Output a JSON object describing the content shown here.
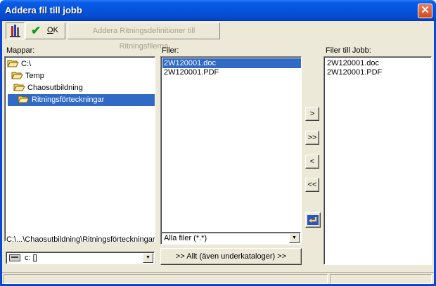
{
  "window": {
    "title": "Addera fil till jobb"
  },
  "toolbar": {
    "ok_label": "OK",
    "ok_hotkey": "O",
    "ok_rest": "K",
    "addera_label": "Addera Ritningsdefinitioner till Ritningsfilerna"
  },
  "mappar": {
    "label": "Mappar:",
    "items": [
      {
        "name": "C:\\",
        "level": 0
      },
      {
        "name": "Temp",
        "level": 1
      },
      {
        "name": "Chaosutbildning",
        "level": 2
      },
      {
        "name": "Ritningsförteckningar",
        "level": 3,
        "selected": true
      }
    ],
    "path": "C:\\...\\Chaosutbildning\\Ritningsförteckningar",
    "drive": "c: []"
  },
  "filer": {
    "label": "Filer:",
    "items": [
      "2W120001.doc",
      "2W120001.PDF"
    ],
    "selected_index": 0,
    "filter": "Alla filer (*.*)",
    "all_button": ">> Allt (även underkataloger) >>"
  },
  "jobb": {
    "label": "Filer till Jobb:",
    "items": [
      "2W120001.doc",
      "2W120001.PDF"
    ]
  },
  "move_buttons": {
    "add": ">",
    "add_all": ">>",
    "remove": "<",
    "remove_all": "<<"
  },
  "colors": {
    "selection": "#316ac5",
    "titlebar": "#0453d9",
    "face": "#ece9d8"
  }
}
